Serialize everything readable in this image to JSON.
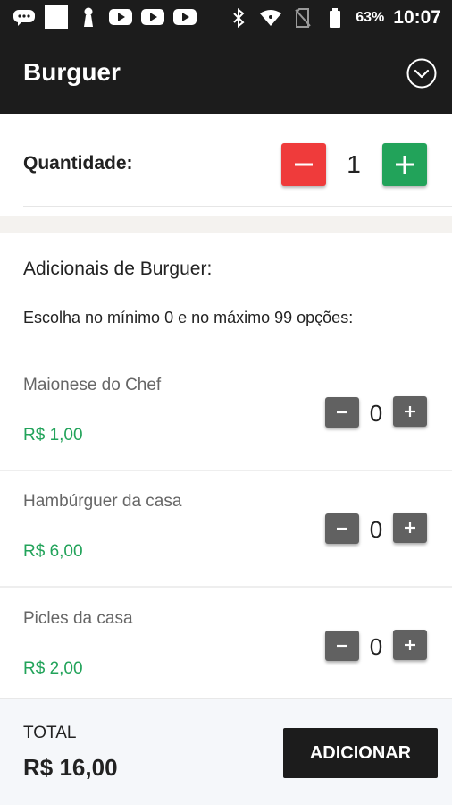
{
  "status_bar": {
    "left_icons": [
      "chat-bubble-icon",
      "white-square-icon",
      "keyhole-icon",
      "youtube-icon",
      "youtube-icon",
      "youtube-icon"
    ],
    "right_icons": [
      "bluetooth-icon",
      "wifi-icon",
      "no-sim-icon",
      "battery-icon"
    ],
    "battery": "63%",
    "time": "10:07"
  },
  "app_bar": {
    "title": "Burguer",
    "menu_icon": "chevron-down-circle-icon"
  },
  "quantity": {
    "label": "Quantidade:",
    "minus": "−",
    "plus": "+",
    "value": "1"
  },
  "additionals": {
    "title": "Adicionais de Burguer:",
    "subtitle": "Escolha no mínimo 0 e no máximo 99 opções:",
    "items": [
      {
        "name": "Maionese do Chef",
        "price": "R$ 1,00",
        "count": "0"
      },
      {
        "name": "Hambúrguer da casa",
        "price": "R$ 6,00",
        "count": "0"
      },
      {
        "name": "Picles da casa",
        "price": "R$ 2,00",
        "count": "0"
      }
    ],
    "minus": "−",
    "plus": "+"
  },
  "footer": {
    "total_label": "TOTAL",
    "total_value": "R$ 16,00",
    "add_label": "ADICIONAR"
  },
  "colors": {
    "bar": "#1c1c1c",
    "minus_red": "#ef3b3b",
    "plus_green": "#22a35a",
    "price_green": "#22a35a",
    "small_button": "#616161"
  }
}
